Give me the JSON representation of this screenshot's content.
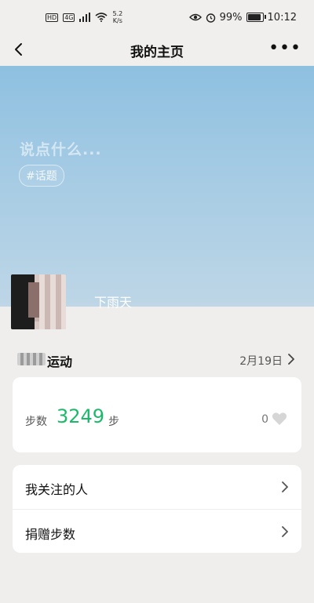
{
  "statusbar": {
    "hd": "HD",
    "net": "4G",
    "speed_value": "5.2",
    "speed_unit": "K/s",
    "battery": "99%",
    "battery_level": 0.99,
    "time": "10:12"
  },
  "navbar": {
    "title": "我的主页"
  },
  "hero": {
    "placeholder": "说点什么...",
    "topic": "#话题",
    "nickname": "下雨天"
  },
  "motion": {
    "label": "运动",
    "date": "2月19日"
  },
  "steps": {
    "label": "步数",
    "value": "3249",
    "unit": "步",
    "likes": "0"
  },
  "menu": {
    "items": [
      {
        "label": "我关注的人"
      },
      {
        "label": "捐赠步数"
      }
    ]
  },
  "colors": {
    "accent_green": "#1db96a",
    "hero_sky": "#a5cbe4"
  }
}
